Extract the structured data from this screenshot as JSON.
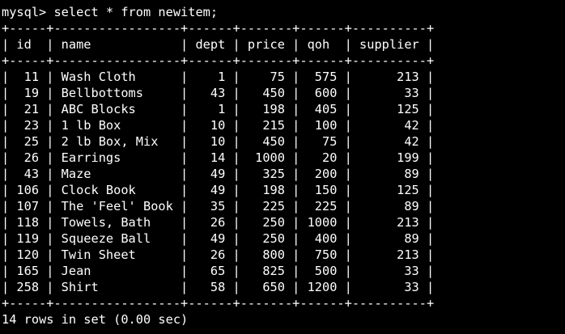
{
  "theme": {
    "background": "#000000",
    "foreground": "#ffffff"
  },
  "terminal": {
    "command_line": "mysql> select * from newitem;",
    "table": {
      "columns": [
        "id",
        "name",
        "dept",
        "price",
        "qoh",
        "supplier"
      ],
      "rows": [
        [
          "11",
          "Wash Cloth",
          "1",
          "75",
          "575",
          "213"
        ],
        [
          "19",
          "Bellbottoms",
          "43",
          "450",
          "600",
          "33"
        ],
        [
          "21",
          "ABC Blocks",
          "1",
          "198",
          "405",
          "125"
        ],
        [
          "23",
          "1 lb Box",
          "10",
          "215",
          "100",
          "42"
        ],
        [
          "25",
          "2 lb Box, Mix",
          "10",
          "450",
          "75",
          "42"
        ],
        [
          "26",
          "Earrings",
          "14",
          "1000",
          "20",
          "199"
        ],
        [
          "43",
          "Maze",
          "49",
          "325",
          "200",
          "89"
        ],
        [
          "106",
          "Clock Book",
          "49",
          "198",
          "150",
          "125"
        ],
        [
          "107",
          "The 'Feel' Book",
          "35",
          "225",
          "225",
          "89"
        ],
        [
          "118",
          "Towels, Bath",
          "26",
          "250",
          "1000",
          "213"
        ],
        [
          "119",
          "Squeeze Ball",
          "49",
          "250",
          "400",
          "89"
        ],
        [
          "120",
          "Twin Sheet",
          "26",
          "800",
          "750",
          "213"
        ],
        [
          "165",
          "Jean",
          "65",
          "825",
          "500",
          "33"
        ],
        [
          "258",
          "Shirt",
          "58",
          "650",
          "1200",
          "33"
        ]
      ]
    },
    "result_summary": "14 rows in set (0.00 sec)"
  }
}
